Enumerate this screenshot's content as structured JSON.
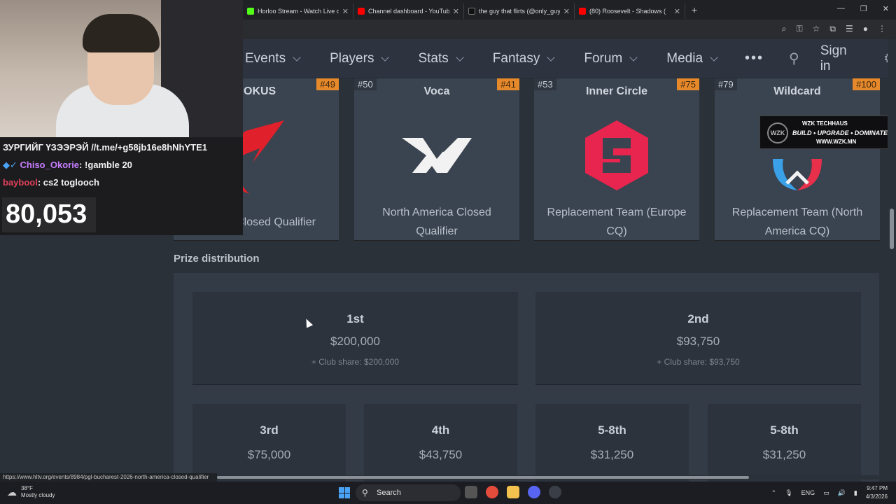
{
  "browser": {
    "tabs": [
      {
        "title": "Horloo Stream - Watch Live on",
        "color": "#53fc18"
      },
      {
        "title": "Channel dashboard - YouTube",
        "color": "#ff0000"
      },
      {
        "title": "the guy that flirts (@only_guy_",
        "color": "#111111"
      },
      {
        "title": "(80) Roosevelt - Shadows (",
        "color": "#ff0000"
      }
    ],
    "new_tab": "+",
    "status_url": "https://www.hltv.org/events/8984/pgl-bucharest-2026-north-america-closed-qualifier"
  },
  "site_nav": {
    "items": [
      "Events",
      "Players",
      "Stats",
      "Fantasy",
      "Forum",
      "Media"
    ],
    "more": "•••",
    "sign_in": "Sign in"
  },
  "teams": [
    {
      "rank_left": "",
      "rank_right": "#49",
      "name": "OKUS",
      "qualifier": "Europe Closed Qualifier"
    },
    {
      "rank_left": "#50",
      "rank_right": "#41",
      "name": "Voca",
      "qualifier": "North America Closed Qualifier"
    },
    {
      "rank_left": "#53",
      "rank_right": "#75",
      "name": "Inner Circle",
      "qualifier": "Replacement Team (Europe CQ)"
    },
    {
      "rank_left": "#79",
      "rank_right": "#100",
      "name": "Wildcard",
      "qualifier": "Replacement Team (North America CQ)"
    }
  ],
  "prize": {
    "title": "Prize distribution",
    "places": [
      {
        "place": "1st",
        "amount": "$200,000",
        "share": "+ Club share: $200,000"
      },
      {
        "place": "2nd",
        "amount": "$93,750",
        "share": "+ Club share: $93,750"
      },
      {
        "place": "3rd",
        "amount": "$75,000"
      },
      {
        "place": "4th",
        "amount": "$43,750"
      },
      {
        "place": "5-8th",
        "amount": "$31,250"
      },
      {
        "place": "5-8th",
        "amount": "$31,250"
      }
    ]
  },
  "stream_overlay": {
    "chat": [
      {
        "text": "ЗУРГИЙГ ҮЗЭЭРЭЙ //t.me/+g58jb16e8hNhYTE1",
        "user": "",
        "color": "#ffffff"
      },
      {
        "user": "Chiso_Okorie",
        "text": ": !gamble 20",
        "color": "#c77dff"
      },
      {
        "user": "baybool",
        "text": ": cs2 toglooch",
        "color": "#e0405a"
      }
    ],
    "counter": "80,053"
  },
  "ad": {
    "brand": "WZK",
    "line1": "WZK TECHHAUS",
    "line2": "BUILD • UPGRADE • DOMINATE",
    "line3": "WWW.WZK.MN"
  },
  "taskbar": {
    "temp": "38°F",
    "weather": "Mostly cloudy",
    "search": "Search",
    "lang": "ENG",
    "time": "9:47 PM",
    "date": "4/3/2026"
  }
}
